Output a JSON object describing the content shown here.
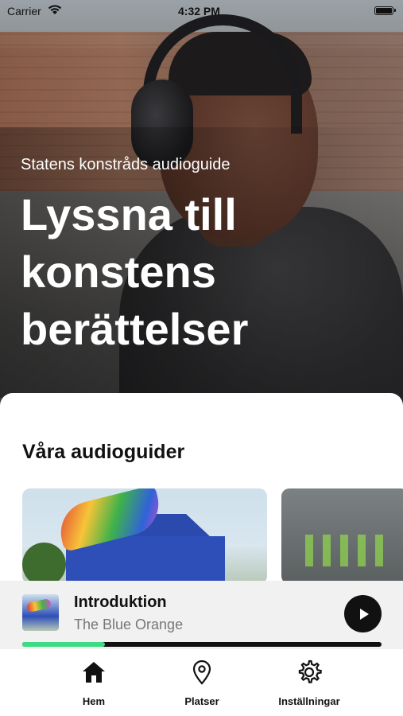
{
  "status_bar": {
    "carrier": "Carrier",
    "time": "4:32 PM",
    "wifi_icon": "wifi-icon",
    "battery_icon": "battery-icon"
  },
  "hero": {
    "subtitle": "Statens konstråds audioguide",
    "title": "Lyssna till\nkonstens\nberättelser"
  },
  "section": {
    "title": "Våra audioguider",
    "cards": [
      {
        "image": "blue-orange-house-photo"
      },
      {
        "image": "tunnel-installation-photo"
      }
    ]
  },
  "player": {
    "title": "Introduktion",
    "subtitle": "The Blue Orange",
    "play_icon": "play-icon",
    "progress": 0.23,
    "progress_color": "#3ddc84"
  },
  "tabs": [
    {
      "label": "Hem",
      "icon": "home-icon",
      "active": true
    },
    {
      "label": "Platser",
      "icon": "location-pin-icon",
      "active": false
    },
    {
      "label": "Inställningar",
      "icon": "gear-icon",
      "active": false
    }
  ]
}
